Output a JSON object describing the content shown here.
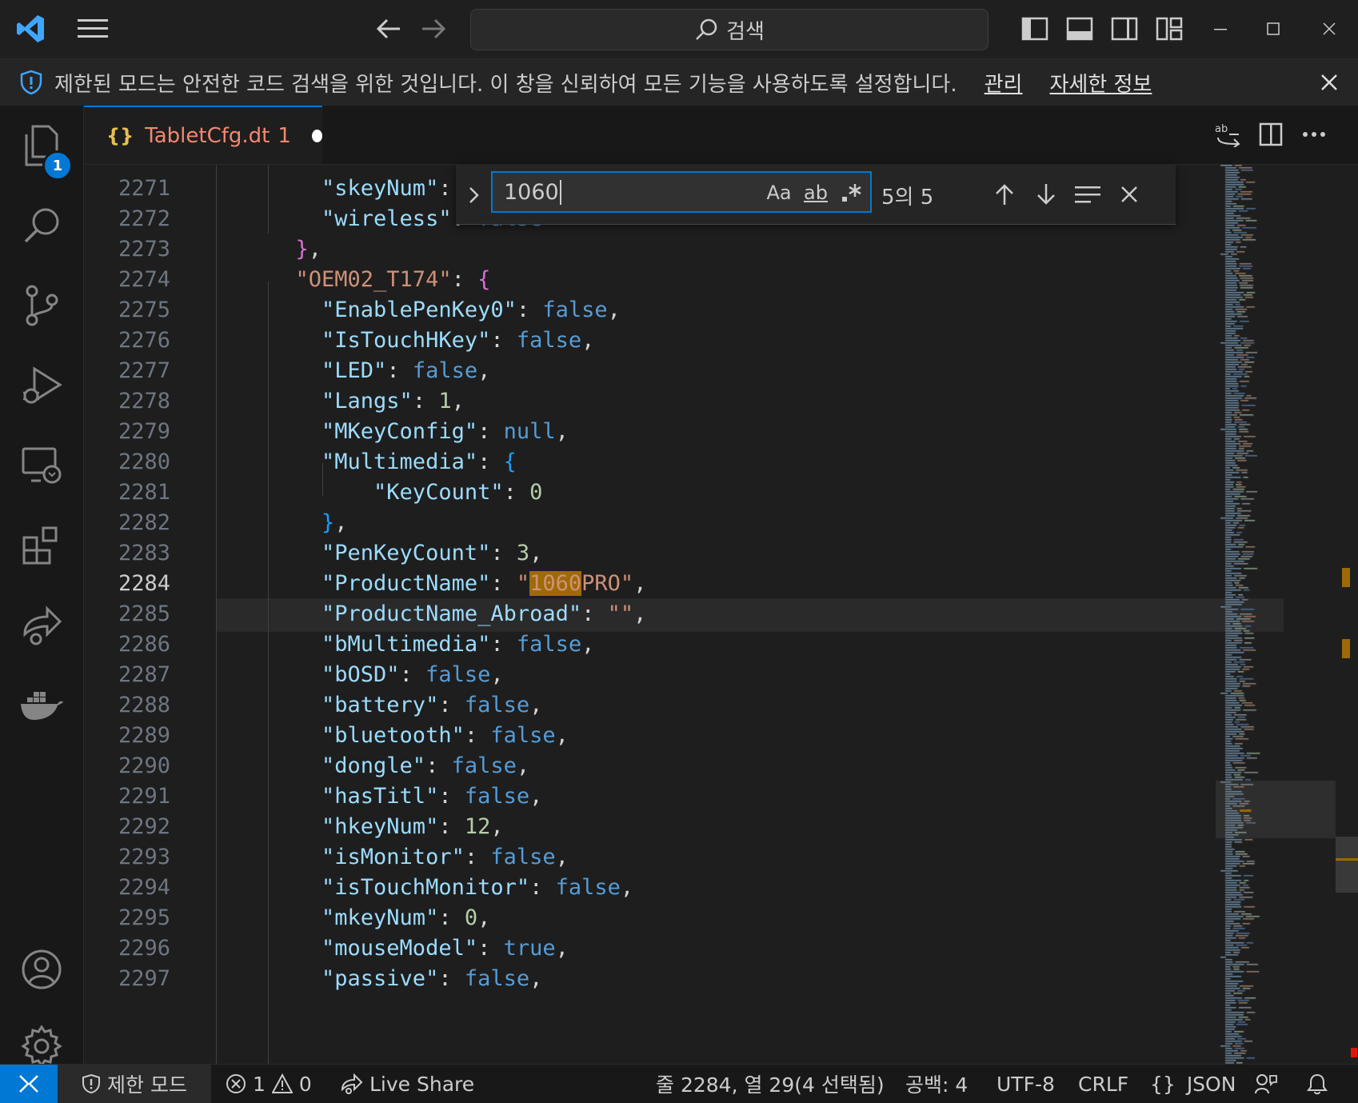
{
  "titlebar": {
    "search_text": "검색"
  },
  "banner": {
    "message": "제한된 모드는 안전한 코드 검색을 위한 것입니다. 이 창을 신뢰하여 모든 기능을 사용하도록 설정합니다.",
    "manage_link": "관리",
    "learn_more_link": "자세한 정보"
  },
  "activitybar": {
    "explorer_badge": "1"
  },
  "tab": {
    "icon": "{}",
    "filename": "TabletCfg.dt",
    "problem_count": "1"
  },
  "find": {
    "query": "1060",
    "match_case": "Aa",
    "whole_word": "ab",
    "count": "5의 5"
  },
  "editor": {
    "active_line": "2284",
    "lines": [
      {
        "no": "2271"
      },
      {
        "no": "2272"
      },
      {
        "no": "2273"
      },
      {
        "no": "2274"
      },
      {
        "no": "2275"
      },
      {
        "no": "2276"
      },
      {
        "no": "2277"
      },
      {
        "no": "2278"
      },
      {
        "no": "2279"
      },
      {
        "no": "2280"
      },
      {
        "no": "2281"
      },
      {
        "no": "2282"
      },
      {
        "no": "2283"
      },
      {
        "no": "2284"
      },
      {
        "no": "2285"
      },
      {
        "no": "2286"
      },
      {
        "no": "2287"
      },
      {
        "no": "2288"
      },
      {
        "no": "2289"
      },
      {
        "no": "2290"
      },
      {
        "no": "2291"
      },
      {
        "no": "2292"
      },
      {
        "no": "2293"
      },
      {
        "no": "2294"
      },
      {
        "no": "2295"
      },
      {
        "no": "2296"
      },
      {
        "no": "2297"
      }
    ]
  },
  "statusbar": {
    "restricted_label": "제한 모드",
    "errors": "1",
    "warnings": "0",
    "live_share": "Live Share",
    "position": "줄 2284, 열 29(4 선택됨)",
    "spaces": "공백: 4",
    "encoding": "UTF-8",
    "eol": "CRLF",
    "language_icon": "{}",
    "language": "JSON"
  },
  "colors": {
    "accent": "#0078d4",
    "find_highlight": "#9e6a03",
    "tab_error_text": "#f48771"
  }
}
